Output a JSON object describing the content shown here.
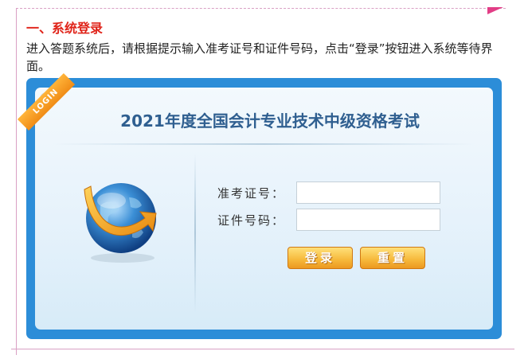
{
  "section": {
    "heading": "一、系统登录",
    "intro": "进入答题系统后，请根据提示输入准考证号和证件号码，点击“登录”按钮进入系统等待界面。"
  },
  "login": {
    "badge": "LOGIN",
    "title": "2021年度全国会计专业技术中级资格考试",
    "fields": [
      {
        "label": "准考证号：",
        "value": ""
      },
      {
        "label": "证件号码：",
        "value": ""
      }
    ],
    "buttons": {
      "login": "登录",
      "reset": "重置"
    }
  },
  "icons": {
    "globe": "globe-arrow-icon"
  },
  "colors": {
    "heading": "#e0241a",
    "panel": "#2c8dd8",
    "title": "#2f5f90",
    "button": "#f6b83a"
  }
}
